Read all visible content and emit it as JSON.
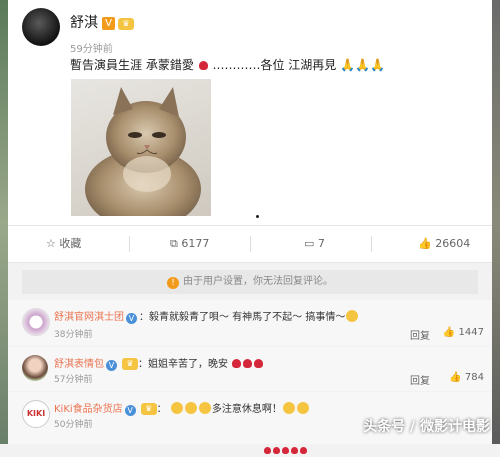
{
  "post": {
    "author": "舒淇",
    "time": "59分钟前",
    "text_main": "暫告演員生涯  承蒙錯愛",
    "text_tail": "…………各位 江湖再見",
    "photo_subject": "cat-photo"
  },
  "actions": {
    "favorite": "收藏",
    "repost_count": "6177",
    "comment_count": "7",
    "like_count": "26604"
  },
  "notice": "由于用户设置，你无法回复评论。",
  "comments": [
    {
      "user": "舒淇官网淇士团",
      "text": "：毅青就毅青了唄～ 有神馬了不起～ 搞事情～",
      "time": "38分钟前",
      "reply": "回复",
      "likes": "1447"
    },
    {
      "user": "舒淇表情包",
      "text": "：姐姐辛苦了，晚安",
      "time": "57分钟前",
      "reply": "回复",
      "likes": "784"
    },
    {
      "user": "KiKi食品杂货店",
      "text_tail": "多注意休息啊！",
      "time": "50分钟前",
      "avatar_text": "KIKI"
    }
  ],
  "watermark": "头条号 / 微影计电影"
}
